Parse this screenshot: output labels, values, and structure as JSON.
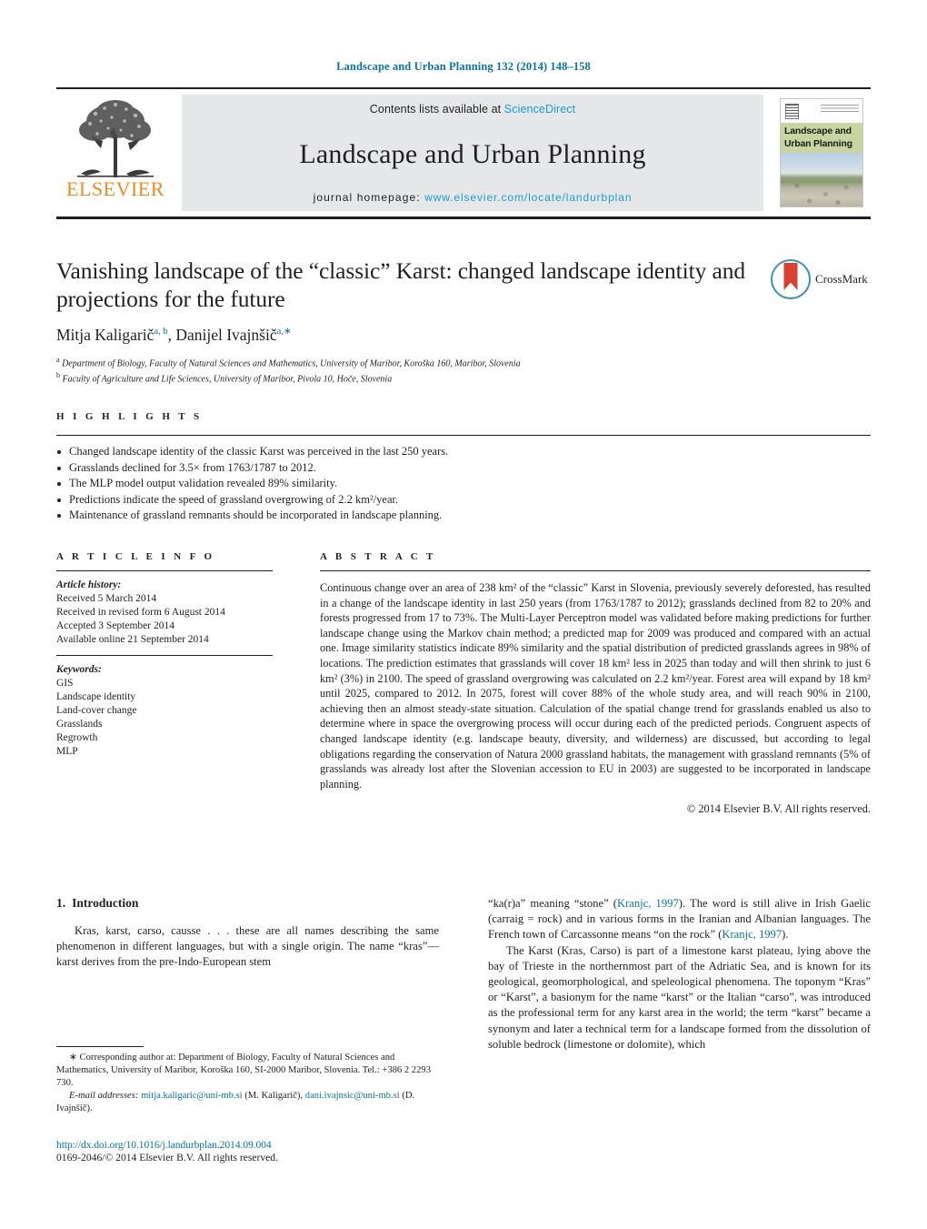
{
  "running_head": "Landscape and Urban Planning 132 (2014) 148–158",
  "masthead": {
    "publisher_logo_text": "ELSEVIER",
    "contents_prefix": "Contents lists available at ",
    "contents_link": "ScienceDirect",
    "journal_title": "Landscape and Urban Planning",
    "homepage_prefix": "journal homepage:",
    "homepage_url": "www.elsevier.com/locate/landurbplan",
    "cover": {
      "line1": "Landscape and",
      "line2": "Urban Planning"
    }
  },
  "article": {
    "title": "Vanishing landscape of the “classic” Karst: changed landscape identity and projections for the future",
    "crossmark_label": "CrossMark",
    "authors_html": "Mitja Kaligarič<sup>a, b</sup>, Danijel Ivajnšič<sup>a,∗</sup>",
    "affiliations": [
      "Department of Biology, Faculty of Natural Sciences and Mathematics, University of Maribor, Koroška 160, Maribor, Slovenia",
      "Faculty of Agriculture and Life Sciences, University of Maribor, Pivola 10, Hoče, Slovenia"
    ],
    "affiliation_markers": [
      "a",
      "b"
    ]
  },
  "highlights": {
    "heading": "H I G H L I G H T S",
    "items": [
      "Changed landscape identity of the classic Karst was perceived in the last 250 years.",
      "Grasslands declined for 3.5× from 1763/1787 to 2012.",
      "The MLP model output validation revealed 89% similarity.",
      "Predictions indicate the speed of grassland overgrowing of 2.2 km²/year.",
      "Maintenance of grassland remnants should be incorporated in landscape planning."
    ]
  },
  "article_info": {
    "heading": "A R T I C L E    I N F O",
    "history_label": "Article history:",
    "history": [
      "Received 5 March 2014",
      "Received in revised form 6 August 2014",
      "Accepted 3 September 2014",
      "Available online 21 September 2014"
    ],
    "keywords_label": "Keywords:",
    "keywords": [
      "GIS",
      "Landscape identity",
      "Land-cover change",
      "Grasslands",
      "Regrowth",
      "MLP"
    ]
  },
  "abstract": {
    "heading": "A B S T R A C T",
    "text": "Continuous change over an area of 238 km² of the “classic” Karst in Slovenia, previously severely deforested, has resulted in a change of the landscape identity in last 250 years (from 1763/1787 to 2012); grasslands declined from 82 to 20% and forests progressed from 17 to 73%. The Multi-Layer Perceptron model was validated before making predictions for further landscape change using the Markov chain method; a predicted map for 2009 was produced and compared with an actual one. Image similarity statistics indicate 89% similarity and the spatial distribution of predicted grasslands agrees in 98% of locations. The prediction estimates that grasslands will cover 18 km² less in 2025 than today and will then shrink to just 6 km² (3%) in 2100. The speed of grassland overgrowing was calculated on 2.2 km²/year. Forest area will expand by 18 km² until 2025, compared to 2012. In 2075, forest will cover 88% of the whole study area, and will reach 90% in 2100, achieving then an almost steady-state situation. Calculation of the spatial change trend for grasslands enabled us also to determine where in space the overgrowing process will occur during each of the predicted periods. Congruent aspects of changed landscape identity (e.g. landscape beauty, diversity, and wilderness) are discussed, but according to legal obligations regarding the conservation of Natura 2000 grassland habitats, the management with grassland remnants (5% of grasslands was already lost after the Slovenian accession to EU in 2003) are suggested to be incorporated in landscape planning.",
    "copyright": "© 2014 Elsevier B.V. All rights reserved."
  },
  "introduction": {
    "number": "1.",
    "heading": "Introduction",
    "left_para_1": "Kras, karst, carso, causse . . . these are all names describing the same phenomenon in different languages, but with a single origin. The name “kras”—karst derives from the pre-Indo-European stem",
    "right_para_1_a": "“ka(r)a” meaning “stone” (",
    "right_ref_1": "Kranjc, 1997",
    "right_para_1_b": "). The word is still alive in Irish Gaelic (carraig = rock) and in various forms in the Iranian and Albanian languages. The French town of Carcassonne means “on the rock” (",
    "right_ref_2": "Kranjc, 1997",
    "right_para_1_c": ").",
    "right_para_2": "The Karst (Kras, Carso) is part of a limestone karst plateau, lying above the bay of Trieste in the northernmost part of the Adriatic Sea, and is known for its geological, geomorphological, and speleological phenomena. The toponym “Kras” or “Karst”, a basionym for the name “karst” or the Italian “carso”, was introduced as the professional term for any karst area in the world; the term “karst” became a synonym and later a technical term for a landscape formed from the dissolution of soluble bedrock (limestone or dolomite), which"
  },
  "footnote": {
    "star": "∗",
    "corresponding": "Corresponding author at: Department of Biology, Faculty of Natural Sciences and Mathematics, University of Maribor, Koroška 160, SI-2000 Maribor, Slovenia. Tel.: +386 2 2293 730.",
    "email_label": "E-mail addresses:",
    "email_1": "mitja.kaligaric@uni-mb.si",
    "email_1_owner": "(M. Kaligarič),",
    "email_2": "dani.ivajnsic@uni-mb.si",
    "email_2_owner": "(D. Ivajnšič)."
  },
  "doi": {
    "url": "http://dx.doi.org/10.1016/j.landurbplan.2014.09.004",
    "issn_line": "0169-2046/© 2014 Elsevier B.V. All rights reserved."
  },
  "colors": {
    "link": "#0a74a6",
    "science_direct": "#1a9bd7",
    "elsevier_orange": "#ed8b22",
    "cover_band": "#c7d6a0",
    "crossmark_red": "#d8402f",
    "crossmark_blue": "#3e8fc0",
    "panel_grey": "#e6e7e8"
  }
}
